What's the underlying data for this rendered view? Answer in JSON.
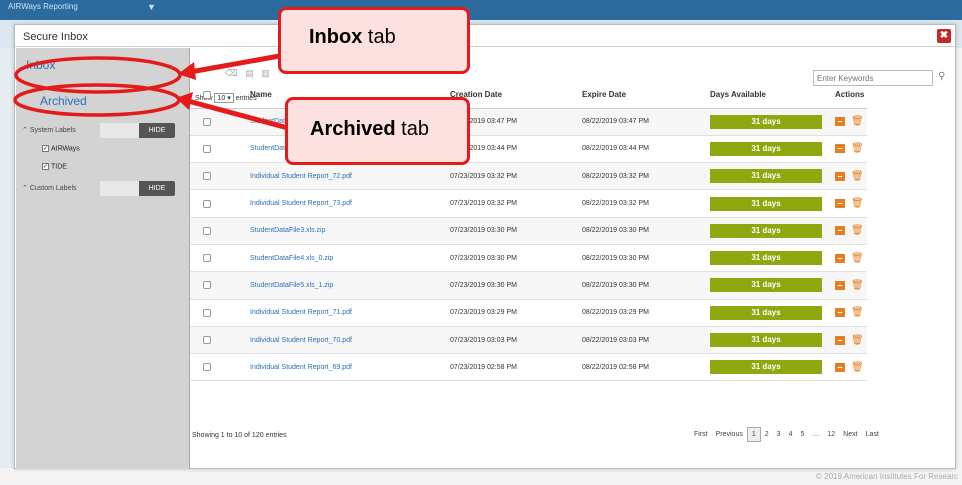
{
  "background": {
    "app_title": "AIRWays Reporting",
    "footer": "© 2019 American Institutes For Researc"
  },
  "modal": {
    "title": "Secure Inbox",
    "close_glyph": "✖"
  },
  "sidebar": {
    "tabs": [
      {
        "label": "Inbox"
      },
      {
        "label": "Archived"
      }
    ],
    "system_labels": {
      "label": "System Labels",
      "toggle": "HIDE",
      "items": [
        "AIRWays",
        "TIDE"
      ]
    },
    "custom_labels": {
      "label": "Custom Labels",
      "toggle": "HIDE"
    }
  },
  "toolbar": {
    "search_placeholder": "Enter Keywords",
    "show_label": "Show",
    "show_value": "10",
    "entries_label": "entries"
  },
  "table": {
    "headers": [
      "Name",
      "Creation Date",
      "Expire Date",
      "Days Available",
      "Actions"
    ],
    "rows": [
      {
        "name": "StudentDataFile1.xls",
        "created": "07/23/2019 03:47 PM",
        "expires": "08/22/2019 03:47 PM",
        "days": "31 days"
      },
      {
        "name": "StudentDataFile2.xls",
        "created": "07/23/2019 03:44 PM",
        "expires": "08/22/2019 03:44 PM",
        "days": "31 days"
      },
      {
        "name": "Individual Student Report_72.pdf",
        "created": "07/23/2019 03:32 PM",
        "expires": "08/22/2019 03:32 PM",
        "days": "31 days"
      },
      {
        "name": "Individual Student Report_73.pdf",
        "created": "07/23/2019 03:32 PM",
        "expires": "08/22/2019 03:32 PM",
        "days": "31 days"
      },
      {
        "name": "StudentDataFile3.xls.zip",
        "created": "07/23/2019 03:30 PM",
        "expires": "08/22/2019 03:30 PM",
        "days": "31 days"
      },
      {
        "name": "StudentDataFile4.xls_0.zip",
        "created": "07/23/2019 03:30 PM",
        "expires": "08/22/2019 03:30 PM",
        "days": "31 days"
      },
      {
        "name": "StudentDataFile5.xls_1.zip",
        "created": "07/23/2019 03:30 PM",
        "expires": "08/22/2019 03:30 PM",
        "days": "31 days"
      },
      {
        "name": "Individual Student Report_71.pdf",
        "created": "07/23/2019 03:29 PM",
        "expires": "08/22/2019 03:29 PM",
        "days": "31 days"
      },
      {
        "name": "Individual Student Report_70.pdf",
        "created": "07/23/2019 03:03 PM",
        "expires": "08/22/2019 03:03 PM",
        "days": "31 days"
      },
      {
        "name": "Individual Student Report_69.pdf",
        "created": "07/23/2019 02:58 PM",
        "expires": "08/22/2019 02:58 PM",
        "days": "31 days"
      }
    ]
  },
  "footer": {
    "info": "Showing 1 to 10 of 120 entries",
    "pages": [
      "First",
      "Previous",
      "1",
      "2",
      "3",
      "4",
      "5",
      "…",
      "12",
      "Next",
      "Last"
    ],
    "current_page": "1"
  },
  "callouts": {
    "inbox": {
      "bold": "Inbox",
      "rest": " tab"
    },
    "archived": {
      "bold": "Archived",
      "rest": " tab"
    }
  },
  "colors": {
    "days_bar": "#8ea80f",
    "action_icons": "#e67e22",
    "callout_border": "#e31b1b",
    "callout_fill": "#fde0e0",
    "close_button": "#c62828"
  }
}
